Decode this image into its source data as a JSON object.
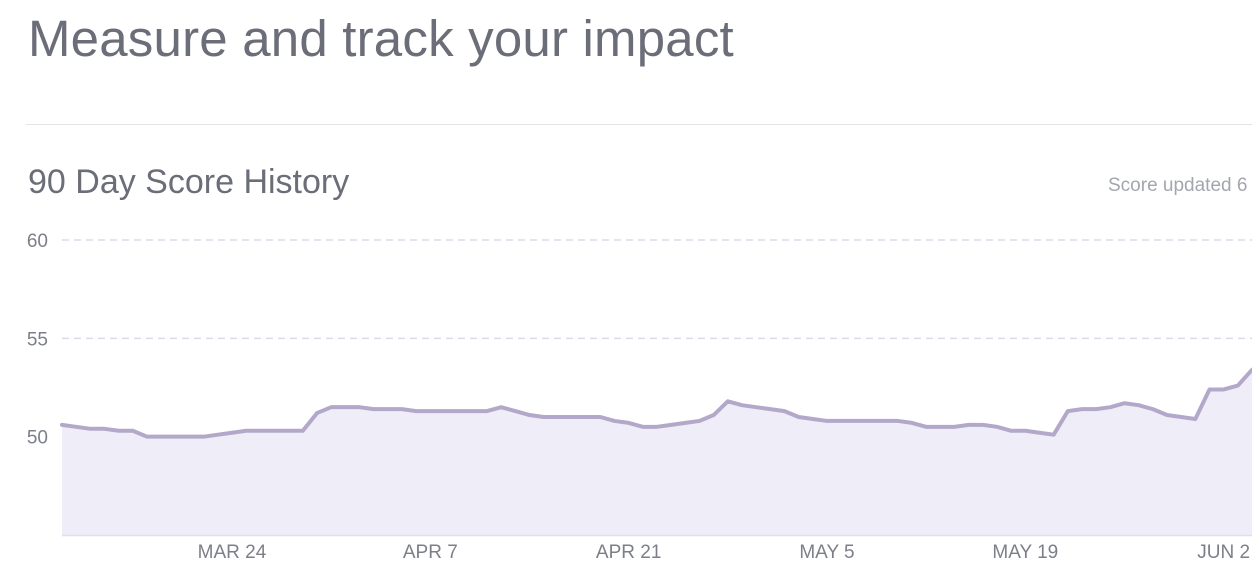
{
  "header": {
    "title": "Measure and track your impact"
  },
  "section": {
    "title": "90 Day Score History",
    "updated_text": "Score updated 6"
  },
  "colors": {
    "line": "#b3a8c9",
    "fill": "#efedf8",
    "grid": "#dcdce6",
    "axis": "#e0e0e8",
    "text": "#7d7f88"
  },
  "chart_data": {
    "type": "area",
    "title": "90 Day Score History",
    "xlabel": "",
    "ylabel": "",
    "ylim": [
      45,
      60
    ],
    "yticks": [
      50,
      55,
      60
    ],
    "xtick_labels": [
      "MAR 24",
      "APR 7",
      "APR 21",
      "MAY 5",
      "MAY 19",
      "JUN 2"
    ],
    "grid": true,
    "series": [
      {
        "values": [
          50.6,
          50.5,
          50.4,
          50.4,
          50.3,
          50.3,
          50.0,
          50.0,
          50.0,
          50.0,
          50.0,
          50.1,
          50.2,
          50.3,
          50.3,
          50.3,
          50.3,
          50.3,
          51.2,
          51.5,
          51.5,
          51.5,
          51.4,
          51.4,
          51.4,
          51.3,
          51.3,
          51.3,
          51.3,
          51.3,
          51.3,
          51.5,
          51.3,
          51.1,
          51.0,
          51.0,
          51.0,
          51.0,
          51.0,
          50.8,
          50.7,
          50.5,
          50.5,
          50.6,
          50.7,
          50.8,
          51.1,
          51.8,
          51.6,
          51.5,
          51.4,
          51.3,
          51.0,
          50.9,
          50.8,
          50.8,
          50.8,
          50.8,
          50.8,
          50.8,
          50.7,
          50.5,
          50.5,
          50.5,
          50.6,
          50.6,
          50.5,
          50.3,
          50.3,
          50.2,
          50.1,
          51.3,
          51.4,
          51.4,
          51.5,
          51.7,
          51.6,
          51.4,
          51.1,
          51.0,
          50.9,
          52.4,
          52.4,
          52.6,
          53.4
        ]
      }
    ]
  }
}
